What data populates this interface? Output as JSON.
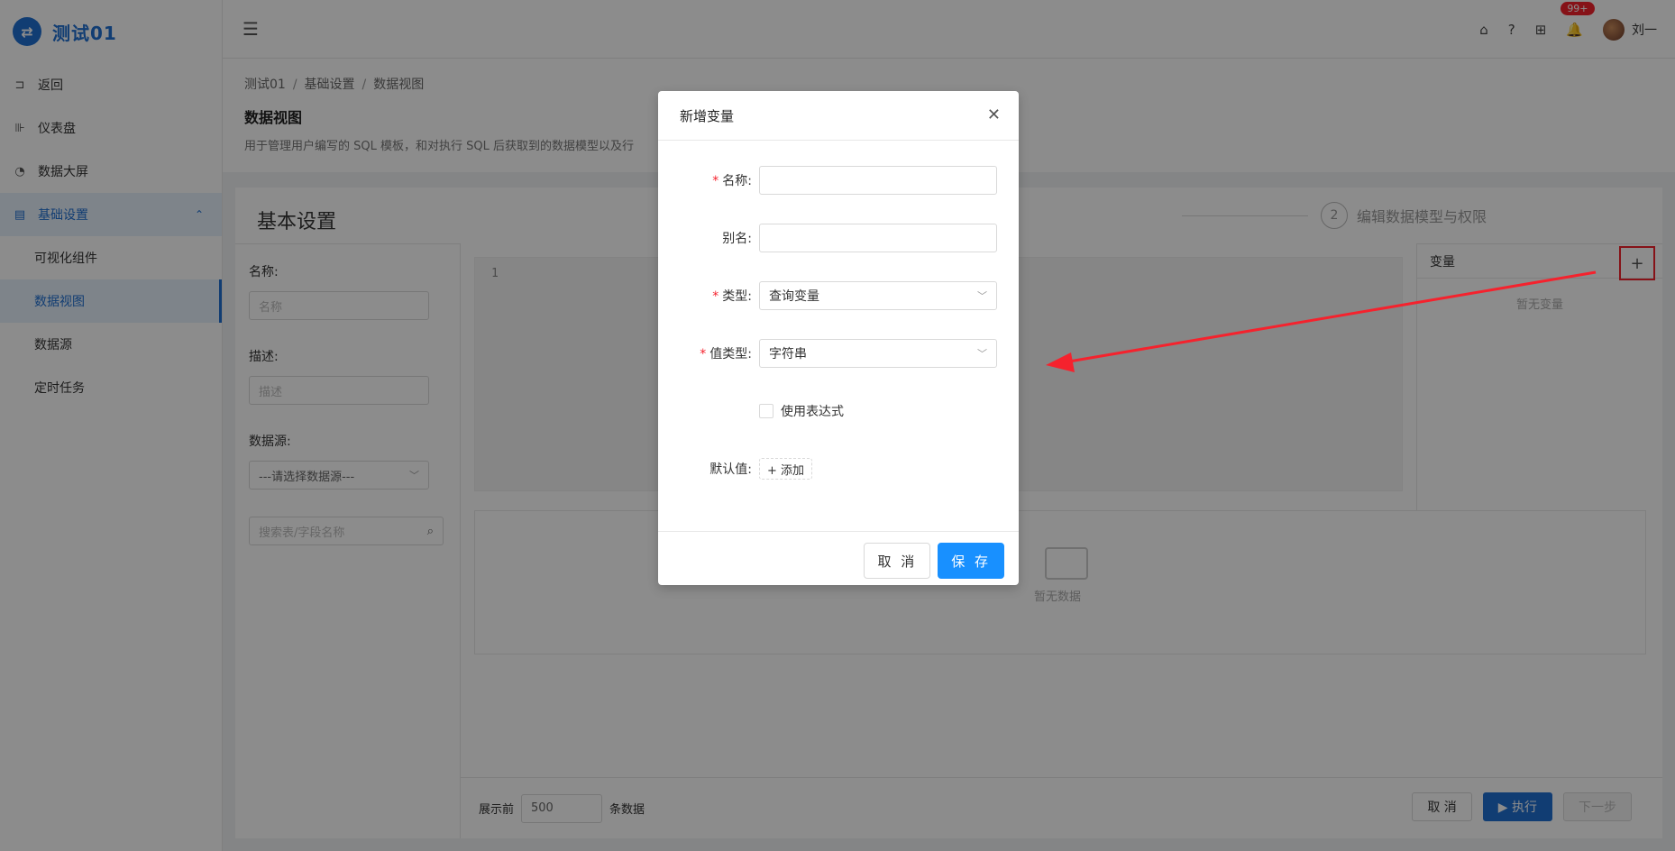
{
  "app": {
    "logo_glyph": "⇄",
    "title": "测试01"
  },
  "sidebar": {
    "items": [
      {
        "label": "返回",
        "icon": "return-icon",
        "glyph": "⊐"
      },
      {
        "label": "仪表盘",
        "icon": "dashboard-icon",
        "glyph": "⊪"
      },
      {
        "label": "数据大屏",
        "icon": "pie-icon",
        "glyph": "◔"
      },
      {
        "label": "基础设置",
        "icon": "settings-doc-icon",
        "glyph": "▤"
      }
    ],
    "submenu": [
      {
        "label": "可视化组件"
      },
      {
        "label": "数据视图"
      },
      {
        "label": "数据源"
      },
      {
        "label": "定时任务"
      }
    ]
  },
  "header": {
    "menu_toggle_glyph": "☰",
    "icons": {
      "home": "⌂",
      "help": "?",
      "apps": "⊞",
      "bell": "🔔"
    },
    "notification_badge": "99+",
    "username": "刘一"
  },
  "breadcrumb": [
    "测试01",
    "基础设置",
    "数据视图"
  ],
  "page": {
    "title": "数据视图",
    "description": "用于管理用户编写的 SQL 模板，和对执行 SQL 后获取到的数据模型以及行"
  },
  "card": {
    "title": "基本设置",
    "step2": {
      "num": "2",
      "label": "编辑数据模型与权限"
    },
    "left": {
      "name_label": "名称:",
      "name_placeholder": "名称",
      "desc_label": "描述:",
      "desc_placeholder": "描述",
      "source_label": "数据源:",
      "source_placeholder": "---请选择数据源---",
      "search_placeholder": "搜索表/字段名称"
    },
    "editor_line": "1",
    "variables": {
      "title": "变量",
      "add_glyph": "+",
      "empty": "暂无变量"
    },
    "result_empty": "暂无数据",
    "footer": {
      "show_prefix": "展示前",
      "limit": "500",
      "show_suffix": "条数据",
      "cancel": "取 消",
      "run": "▶ 执行",
      "next": "下一步"
    }
  },
  "modal": {
    "title": "新增变量",
    "close_glyph": "✕",
    "fields": {
      "name_label": "名称:",
      "name_value": "",
      "alias_label": "别名:",
      "alias_value": "",
      "type_label": "类型:",
      "type_value": "查询变量",
      "value_type_label": "值类型:",
      "value_type_value": "字符串",
      "expression_label": "使用表达式",
      "default_label": "默认值:",
      "add_label": "+ 添加"
    },
    "cancel": "取 消",
    "save": "保 存"
  },
  "colors": {
    "primary": "#1f6fd1",
    "accent": "#1890ff",
    "annotation": "#f5222d"
  }
}
